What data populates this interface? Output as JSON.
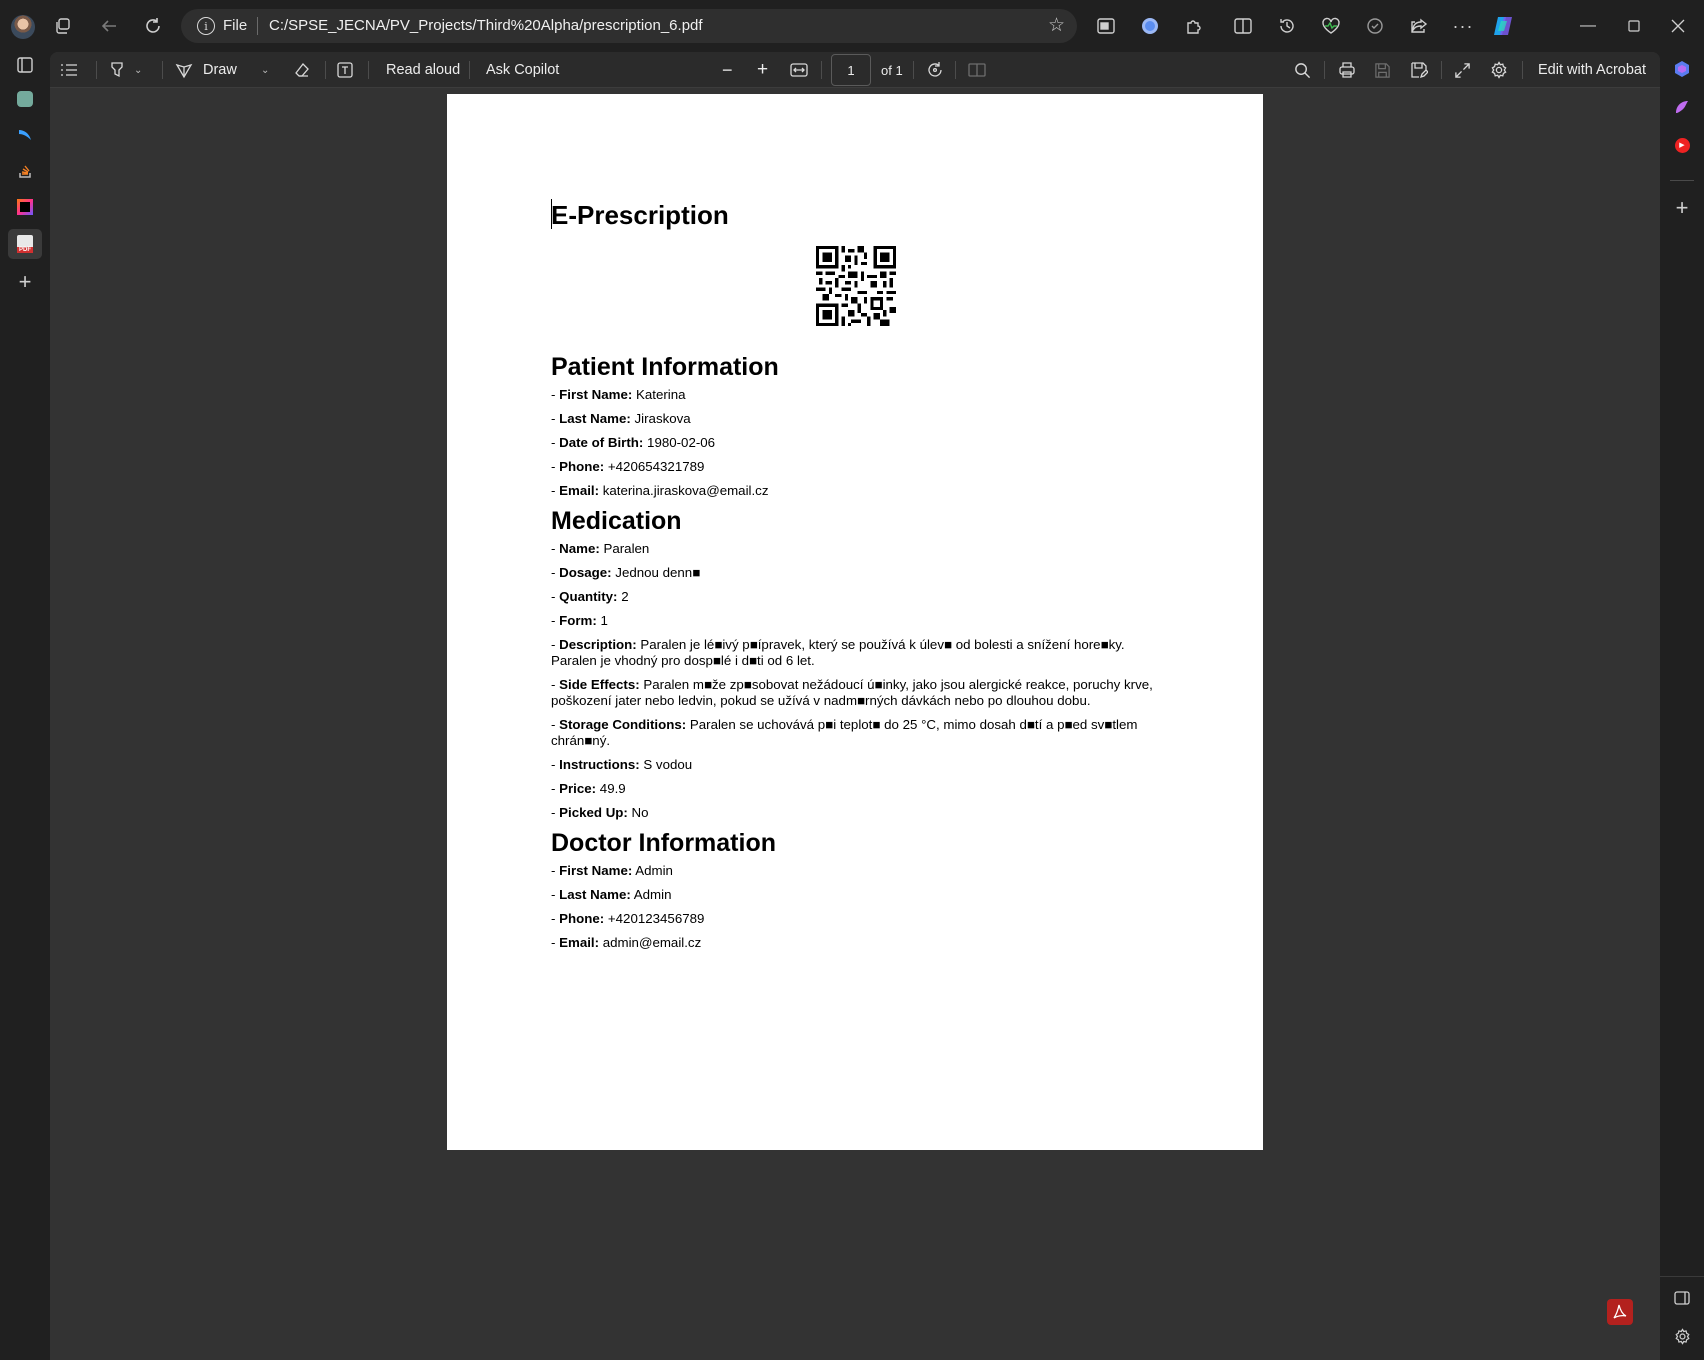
{
  "browser": {
    "address_scheme": "File",
    "address_url": "C:/SPSE_JECNA/PV_Projects/Third%20Alpha/prescription_6.pdf"
  },
  "pdf_toolbar": {
    "draw_label": "Draw",
    "read_aloud_label": "Read aloud",
    "ask_copilot_label": "Ask Copilot",
    "page_current": "1",
    "page_total_label": "of 1",
    "edit_acrobat_label": "Edit with Acrobat"
  },
  "document": {
    "title": "E-Prescription",
    "patient": {
      "heading": "Patient Information",
      "fields": [
        {
          "label": "First Name:",
          "value": "Katerina"
        },
        {
          "label": "Last Name:",
          "value": "Jiraskova"
        },
        {
          "label": "Date of Birth:",
          "value": "1980-02-06"
        },
        {
          "label": "Phone:",
          "value": "+420654321789"
        },
        {
          "label": "Email:",
          "value": "katerina.jiraskova@email.cz"
        }
      ]
    },
    "medication": {
      "heading": "Medication",
      "fields": [
        {
          "label": "Name:",
          "value": "Paralen"
        },
        {
          "label": "Dosage:",
          "value": "Jednou denn■"
        },
        {
          "label": "Quantity:",
          "value": "2"
        },
        {
          "label": "Form:",
          "value": "1"
        },
        {
          "label": "Description:",
          "value": "Paralen je lé■ivý p■ípravek, který se používá k úlev■ od bolesti a snížení hore■ky. Paralen je vhodný pro dosp■lé i d■ti od 6 let."
        },
        {
          "label": "Side Effects:",
          "value": "Paralen m■že zp■sobovat nežádoucí ú■inky, jako jsou alergické reakce, poruchy krve, poškození jater nebo ledvin, pokud se užívá v nadm■rných dávkách nebo po dlouhou dobu."
        },
        {
          "label": "Storage Conditions:",
          "value": "Paralen se uchovává p■i teplot■ do 25 °C, mimo dosah d■tí a p■ed sv■tlem chrán■ný."
        },
        {
          "label": "Instructions:",
          "value": "S vodou"
        },
        {
          "label": "Price:",
          "value": "49.9"
        },
        {
          "label": "Picked Up:",
          "value": "No"
        }
      ]
    },
    "doctor": {
      "heading": "Doctor Information",
      "fields": [
        {
          "label": "First Name:",
          "value": "Admin"
        },
        {
          "label": "Last Name:",
          "value": "Admin"
        },
        {
          "label": "Phone:",
          "value": "+420123456789"
        },
        {
          "label": "Email:",
          "value": "admin@email.cz"
        }
      ]
    }
  },
  "icons": [
    "profile-avatar",
    "tab-actions-icon",
    "back-icon",
    "refresh-icon",
    "info-icon",
    "favorite-star-icon",
    "contents-icon",
    "highlight-icon",
    "draw-icon",
    "eraser-icon",
    "text-icon",
    "zoom-out-icon",
    "zoom-in-icon",
    "fit-page-icon",
    "rotate-icon",
    "page-view-icon",
    "search-icon",
    "print-icon",
    "save-icon",
    "save-as-icon",
    "fullscreen-icon",
    "settings-icon",
    "adobe-acrobat-icon"
  ],
  "colors": {
    "chrome_bg": "#202020",
    "viewer_bg": "#333333",
    "page_bg": "#ffffff",
    "acrobat_red": "#b3211e"
  }
}
